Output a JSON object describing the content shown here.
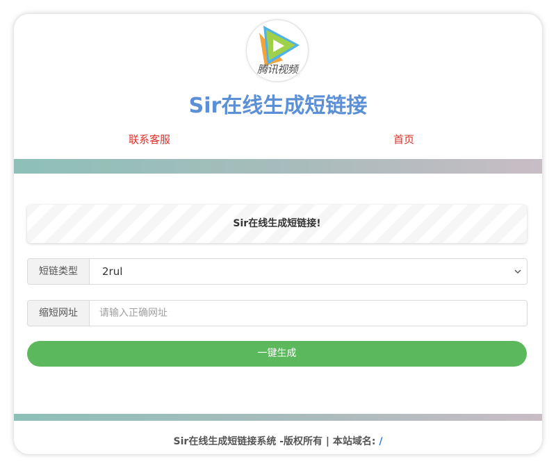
{
  "header": {
    "logo_text": "腾讯视频",
    "site_title": "Sir在线生成短链接",
    "nav": {
      "contact": "联系客服",
      "home": "首页"
    }
  },
  "notice": {
    "text": "Sir在线生成短链接!"
  },
  "form": {
    "type_label": "短链类型",
    "type_selected": "2rul",
    "url_label": "缩短网址",
    "url_value": "",
    "url_placeholder": "请输入正确网址",
    "generate_label": "一键生成"
  },
  "footer": {
    "copyright": "Sir在线生成短链接系统 -版权所有 | 本站域名: ",
    "domain_link": "/"
  },
  "colors": {
    "title": "#5b8fd6",
    "nav_link": "#e0302a",
    "button": "#5cb85c",
    "stripe_start": "#8dc0b7",
    "stripe_end": "#c8bdc4"
  },
  "icons": {
    "logo": "tencent-video-logo",
    "select_arrow": "chevron-down-icon"
  }
}
